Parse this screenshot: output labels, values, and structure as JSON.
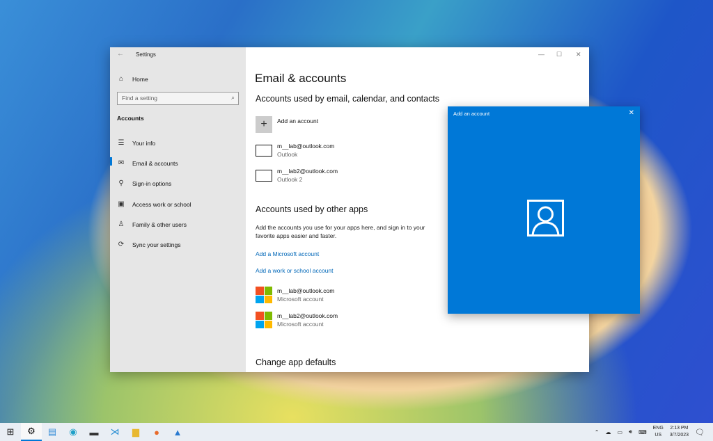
{
  "settings": {
    "title": "Settings",
    "home": "Home",
    "search_placeholder": "Find a setting",
    "category": "Accounts",
    "nav": [
      {
        "label": "Your info",
        "icon": "person-list-icon"
      },
      {
        "label": "Email & accounts",
        "icon": "mail-icon"
      },
      {
        "label": "Sign-in options",
        "icon": "key-icon"
      },
      {
        "label": "Access work or school",
        "icon": "briefcase-icon"
      },
      {
        "label": "Family & other users",
        "icon": "person-add-icon"
      },
      {
        "label": "Sync your settings",
        "icon": "sync-icon"
      }
    ]
  },
  "main": {
    "title": "Email & accounts",
    "section1": "Accounts used by email, calendar, and contacts",
    "add_account": "Add an account",
    "email_accounts": [
      {
        "email": "m__lab@outlook.com",
        "type": "Outlook"
      },
      {
        "email": "m__lab2@outlook.com",
        "type": "Outlook 2"
      }
    ],
    "section2": "Accounts used by other apps",
    "section2_desc": "Add the accounts you use for your apps here, and sign in to your favorite apps easier and faster.",
    "link_ms": "Add a Microsoft account",
    "link_work": "Add a work or school account",
    "app_accounts": [
      {
        "email": "m__lab@outlook.com",
        "type": "Microsoft account"
      },
      {
        "email": "m__lab2@outlook.com",
        "type": "Microsoft account"
      }
    ],
    "section3": "Change app defaults"
  },
  "dialog": {
    "title": "Add an account",
    "accent": "#0078d7"
  },
  "tray": {
    "lang1": "ENG",
    "lang2": "US",
    "time": "2:13 PM",
    "date": "3/7/2023"
  }
}
